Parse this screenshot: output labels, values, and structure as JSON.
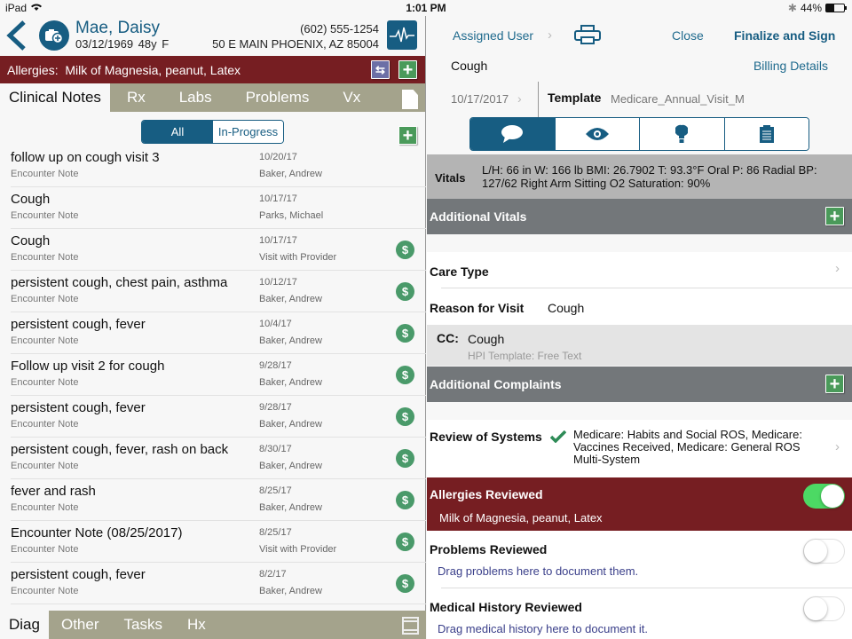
{
  "status_bar": {
    "device": "iPad",
    "time": "1:01 PM",
    "battery": "44%",
    "battery_level": 0.44
  },
  "patient": {
    "name": "Mae, Daisy",
    "dob_age_sex": "03/12/1969  48y  F",
    "phone": "(602) 555-1254",
    "address": "50 E MAIN PHOENIX, AZ 85004",
    "allergies_label": "Allergies:",
    "allergies": "Milk of Magnesia, peanut, Latex"
  },
  "top_tabs": [
    {
      "label": "Clinical Notes",
      "active": true
    },
    {
      "label": "Rx",
      "active": false
    },
    {
      "label": "Labs",
      "active": false
    },
    {
      "label": "Problems",
      "active": false
    },
    {
      "label": "Vx",
      "active": false
    }
  ],
  "filter": {
    "all": "All",
    "in_progress": "In-Progress",
    "selected": "All"
  },
  "notes": [
    {
      "title": "follow up on cough visit 3",
      "type": "Encounter Note",
      "date": "10/20/17",
      "who": "Baker, Andrew",
      "billed": false
    },
    {
      "title": "Cough",
      "type": "Encounter Note",
      "date": "10/17/17",
      "who": "Parks, Michael",
      "billed": false
    },
    {
      "title": "Cough",
      "type": "Encounter Note",
      "date": "10/17/17",
      "who": "Visit with Provider",
      "billed": true
    },
    {
      "title": "persistent cough, chest pain, asthma",
      "type": "Encounter Note",
      "date": "10/12/17",
      "who": "Baker, Andrew",
      "billed": true
    },
    {
      "title": "persistent cough, fever",
      "type": "Encounter Note",
      "date": "10/4/17",
      "who": "Baker, Andrew",
      "billed": true
    },
    {
      "title": "Follow up visit 2 for cough",
      "type": "Encounter Note",
      "date": "9/28/17",
      "who": "Baker, Andrew",
      "billed": true
    },
    {
      "title": "persistent cough, fever",
      "type": "Encounter Note",
      "date": "9/28/17",
      "who": "Baker, Andrew",
      "billed": true
    },
    {
      "title": "persistent cough, fever, rash on back",
      "type": "Encounter Note",
      "date": "8/30/17",
      "who": "Baker, Andrew",
      "billed": true
    },
    {
      "title": "fever and rash",
      "type": "Encounter Note",
      "date": "8/25/17",
      "who": "Baker, Andrew",
      "billed": true
    },
    {
      "title": "Encounter Note (08/25/2017)",
      "type": "Encounter Note",
      "date": "8/25/17",
      "who": "Visit with Provider",
      "billed": true
    },
    {
      "title": "persistent cough, fever",
      "type": "Encounter Note",
      "date": "8/2/17",
      "who": "Baker, Andrew",
      "billed": true
    }
  ],
  "bill_symbol": "$",
  "bottom_tabs": [
    {
      "label": "Diag",
      "active": true
    },
    {
      "label": "Other",
      "active": false
    },
    {
      "label": "Tasks",
      "active": false
    },
    {
      "label": "Hx",
      "active": false
    }
  ],
  "detail": {
    "assigned_user": "Assigned User",
    "close": "Close",
    "finalize": "Finalize and Sign",
    "note_title": "Cough",
    "billing_details": "Billing Details",
    "date": "10/17/2017",
    "template_label": "Template",
    "template_value": "Medicare_Annual_Visit_M",
    "view_tabs": [
      "chat-icon",
      "eye-icon",
      "lightbulb-icon",
      "clipboard-icon"
    ],
    "vitals_label": "Vitals",
    "vitals_value": "L/H: 66 in W: 166 lb BMI: 26.7902 T: 93.3°F Oral P: 86 Radial BP: 127/62 Right Arm Sitting O2 Saturation: 90%",
    "additional_vitals": "Additional Vitals",
    "care_type": "Care Type",
    "reason_label": "Reason for Visit",
    "reason_value": "Cough",
    "cc_label": "CC:",
    "cc_value": "Cough",
    "hpi_template": "HPI Template: Free Text",
    "additional_complaints": "Additional Complaints",
    "ros_label": "Review of Systems",
    "ros_value": "Medicare: Habits and Social ROS, Medicare: Vaccines Received, Medicare: General ROS Multi-System",
    "allergies_reviewed": "Allergies Reviewed",
    "allergies_reviewed_on": true,
    "allergies_value": "Milk of Magnesia, peanut, Latex",
    "problems_reviewed": "Problems Reviewed",
    "problems_reviewed_on": false,
    "problems_hint": "Drag problems here to document them.",
    "history_reviewed": "Medical History Reviewed",
    "history_reviewed_on": false,
    "history_hint": "Drag medical history here to document it."
  },
  "colors": {
    "brand": "#175d82",
    "allergy_red": "#761e22",
    "tab_olive": "#a4a38c",
    "add_green": "#4a9a5a",
    "toggle_on": "#4cd964"
  }
}
